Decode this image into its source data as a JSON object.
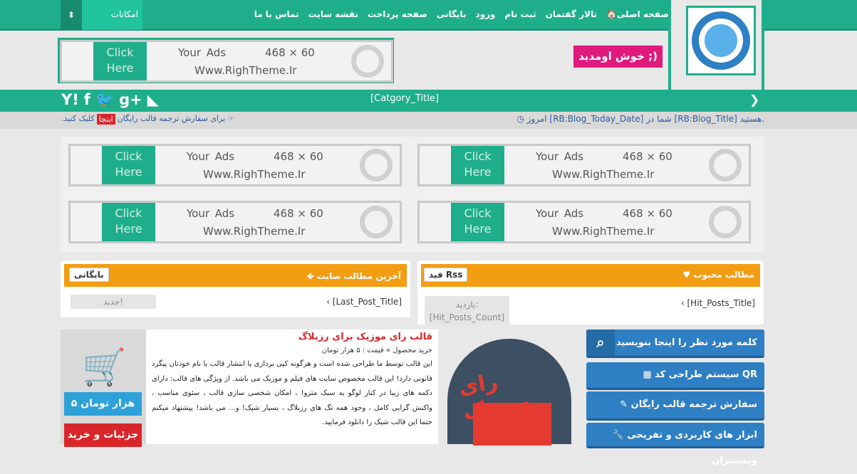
{
  "header": {
    "features_label": "امکانات",
    "toggle_icon": "chevron-updown-icon",
    "nav": [
      "صفحه اصلی",
      "تالار گفتمان",
      "ثبت نام",
      "ورود",
      "بایگانی",
      "صفحه پرداخت",
      "نقشه سایت",
      "تماس با ما"
    ],
    "welcome": "خوش اومدید ;)"
  },
  "ad": {
    "click": "Click",
    "here": "Here",
    "your_ads": "Your Ads",
    "size": "468 × 60",
    "url": "Www.RighTheme.Ir"
  },
  "catbar": {
    "title": "[Catgory_Title]"
  },
  "infobar": {
    "today": "امروز [RB:Blog_Today_Date] شما در [RB:Blog_Title] هستید.",
    "order_text": "برای سفارش ترجمه قالب رایگان",
    "here_btn": "اینجا",
    "click_text": "کلیک کنید."
  },
  "latest": {
    "title": "آخرین مطالب سایت",
    "archive": "بایگانی",
    "post": "[Last_Post_Title]",
    "new": "جدید!"
  },
  "popular": {
    "title": "مطالب محبوب",
    "rss": "فید Rss",
    "post": "[Hit_Posts_Title]",
    "visits": "بازدید:",
    "count": "[Hit_Posts_Count]"
  },
  "product": {
    "title": "قالب رای موزیک برای رزبلاگ",
    "meta": "خرید محصول » قیمت : ۵ هزار تومان",
    "desc": "این قالب توسط ما طراحی شده است و هرگونه کپی برداری یا انتشار قالب با نام خودتان پیگرد قانونی دارد! این قالب مخصوص سایت های فیلم و موزیک می باشد. از ویژگی های قالب: دارای دکمه های زیبا در کنار لوگو به سبک مترو! ، امکان شخصی سازی قالب ، سئوی مناسب ، واکنش گرایی کامل ، وجود همه تگ های رزبلاگ ، بسیار شیک! و... می باشد! پیشنهاد میکنم حتما این قالب شیک را دانلود فرمایید.",
    "price": "۵ هزار تومان",
    "details": "جزئیات و خرید",
    "image_text": "رای موزیک"
  },
  "sidebar": {
    "search_placeholder": "کلمه مورد نظر را اینجا بنویسید",
    "items": [
      "سیستم طراحی کد QR",
      "سفارش ترجمه قالب رایگان",
      "ابزار های کاربردی و تفریحی وبمستران"
    ]
  },
  "colors": {
    "accent": "#1fae8c",
    "orange": "#f29d12",
    "blue": "#2e7fc3",
    "red": "#d9262a",
    "pink": "#e0197d"
  }
}
